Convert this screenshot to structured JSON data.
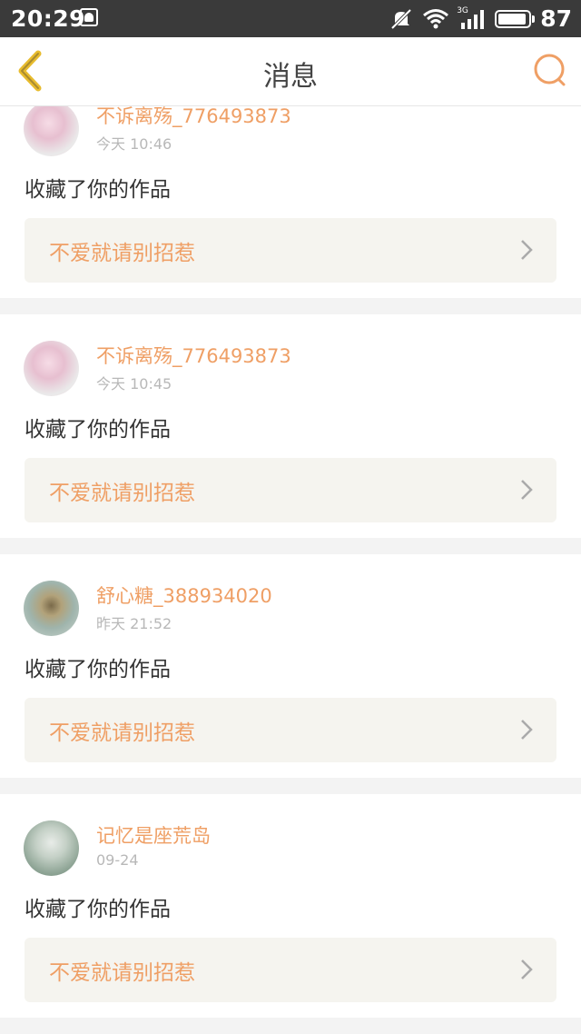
{
  "status_bar": {
    "time": "20:29",
    "network": "3G",
    "battery": "87"
  },
  "header": {
    "title": "消息"
  },
  "colors": {
    "accent": "#ef9f65",
    "back_icon": "#e8bc2e",
    "card_work_bg": "#f5f4ef"
  },
  "messages": [
    {
      "user": "不诉离殇_776493873",
      "time": "今天 10:46",
      "action": "收藏了你的作品",
      "work": "不爱就请别招惹"
    },
    {
      "user": "不诉离殇_776493873",
      "time": "今天 10:45",
      "action": "收藏了你的作品",
      "work": "不爱就请别招惹"
    },
    {
      "user": "舒心糖_388934020",
      "time": "昨天 21:52",
      "action": "收藏了你的作品",
      "work": "不爱就请别招惹"
    },
    {
      "user": "记忆是座荒岛",
      "time": "09-24",
      "action": "收藏了你的作品",
      "work": "不爱就请别招惹"
    }
  ]
}
